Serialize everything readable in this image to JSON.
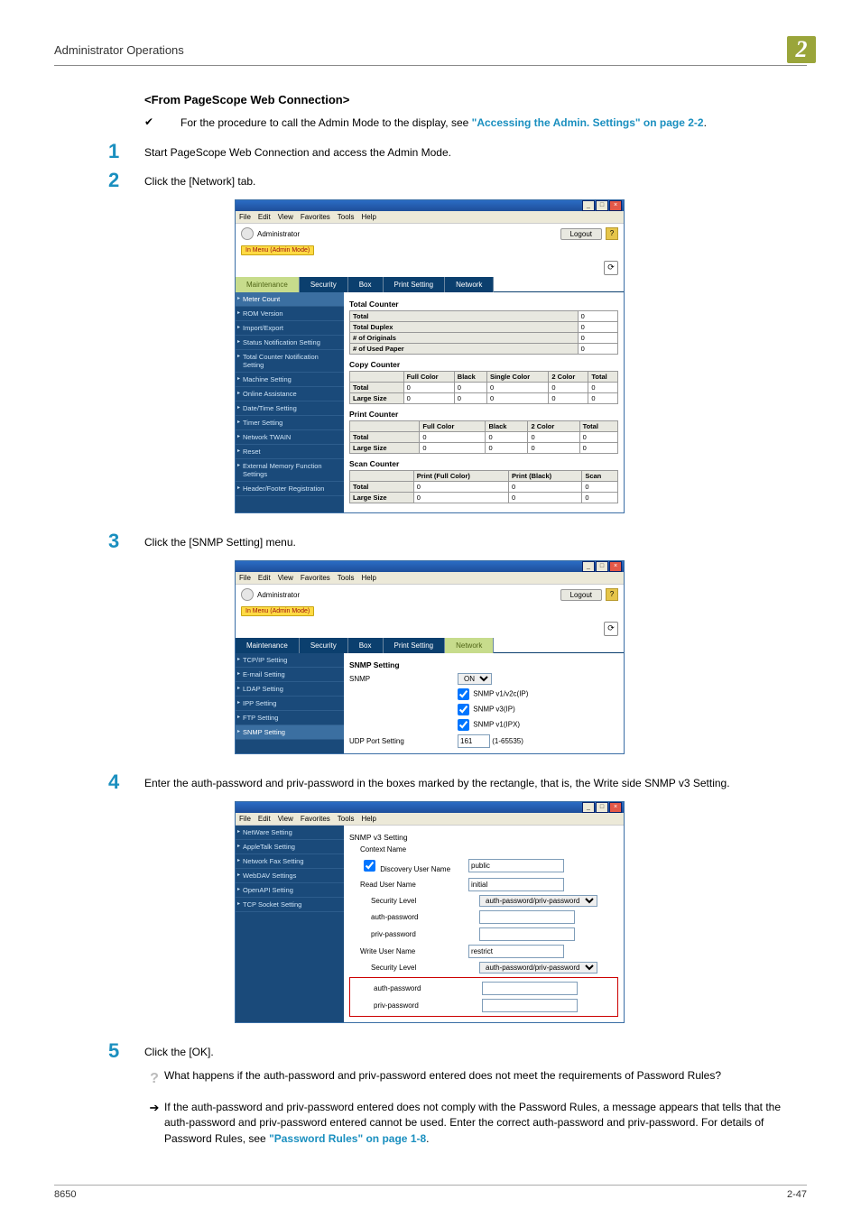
{
  "header": {
    "title": "Administrator Operations",
    "chapter": "2"
  },
  "subheading": "<From PageScope Web Connection>",
  "intro": {
    "check": "✔",
    "before_link": "For the procedure to call the Admin Mode to the display, see ",
    "link": "\"Accessing the Admin. Settings\" on page 2-2",
    "after_link": "."
  },
  "steps": {
    "s1": {
      "num": "1",
      "text": "Start PageScope Web Connection and access the Admin Mode."
    },
    "s2": {
      "num": "2",
      "text": "Click the [Network] tab."
    },
    "s3": {
      "num": "3",
      "text": "Click the [SNMP Setting] menu."
    },
    "s4": {
      "num": "4",
      "text": "Enter the auth-password and priv-password in the boxes marked by the rectangle, that is, the Write side SNMP v3 Setting."
    },
    "s5": {
      "num": "5",
      "text": "Click the [OK]."
    }
  },
  "qa": {
    "q_icon": "?",
    "q_text": "What happens if the auth-password and priv-password entered does not meet the requirements of Password Rules?",
    "a_icon": "➔",
    "a_before_link": "If the auth-password and priv-password entered does not comply with the Password Rules, a message appears that tells that the auth-password and priv-password entered cannot be used. Enter the correct auth-password and priv-password. For details of Password Rules, see ",
    "a_link": "\"Password Rules\" on page 1-8",
    "a_after_link": "."
  },
  "footer": {
    "left": "8650",
    "right": "2-47"
  },
  "browser": {
    "menus": {
      "file": "File",
      "edit": "Edit",
      "view": "View",
      "fav": "Favorites",
      "tools": "Tools",
      "help": "Help"
    },
    "admin_label": "Administrator",
    "mode_badge": "In Menu (Admin Mode)",
    "logout": "Logout",
    "q": "?",
    "win": {
      "min": "_",
      "max": "□",
      "close": "×"
    },
    "refresh": "⟳"
  },
  "tabs": {
    "maintenance": "Maintenance",
    "security": "Security",
    "box": "Box",
    "print": "Print Setting",
    "network": "Network"
  },
  "shot1": {
    "sidebar": [
      "Meter Count",
      "ROM Version",
      "Import/Export",
      "Status Notification Setting",
      "Total Counter Notification Setting",
      "Machine Setting",
      "Online Assistance",
      "Date/Time Setting",
      "Timer Setting",
      "Network TWAIN",
      "Reset",
      "External Memory Function Settings",
      "Header/Footer Registration"
    ],
    "total_counter_title": "Total Counter",
    "total_counter_rows": {
      "Total": "0",
      "Total Duplex": "0",
      "# of Originals": "0",
      "# of Used Paper": "0"
    },
    "copy_counter_title": "Copy Counter",
    "copy_headers": [
      "",
      "Full Color",
      "Black",
      "Single Color",
      "2 Color",
      "Total"
    ],
    "copy_rows": [
      [
        "Total",
        "0",
        "0",
        "0",
        "0",
        "0"
      ],
      [
        "Large Size",
        "0",
        "0",
        "0",
        "0",
        "0"
      ]
    ],
    "print_counter_title": "Print Counter",
    "print_headers": [
      "",
      "Full Color",
      "Black",
      "2 Color",
      "Total"
    ],
    "print_rows": [
      [
        "Total",
        "0",
        "0",
        "0",
        "0"
      ],
      [
        "Large Size",
        "0",
        "0",
        "0",
        "0"
      ]
    ],
    "scan_counter_title": "Scan Counter",
    "scan_headers": [
      "",
      "Print (Full Color)",
      "Print (Black)",
      "Scan"
    ],
    "scan_rows": [
      [
        "Total",
        "0",
        "0",
        "0"
      ],
      [
        "Large Size",
        "0",
        "0",
        "0"
      ]
    ]
  },
  "shot2": {
    "sidebar": [
      "TCP/IP Setting",
      "E-mail Setting",
      "LDAP Setting",
      "IPP Setting",
      "FTP Setting",
      "SNMP Setting"
    ],
    "title": "SNMP Setting",
    "rows": {
      "snmp_label": "SNMP",
      "snmp_value": "ON",
      "cb1": "SNMP v1/v2c(IP)",
      "cb2": "SNMP v3(IP)",
      "cb3": "SNMP v1(IPX)",
      "udp_label": "UDP Port Setting",
      "udp_value": "161",
      "udp_range": "(1-65535)"
    }
  },
  "shot3": {
    "sidebar": [
      "NetWare Setting",
      "AppleTalk Setting",
      "Network Fax Setting",
      "WebDAV Settings",
      "OpenAPI Setting",
      "TCP Socket Setting"
    ],
    "title": "SNMP v3 Setting",
    "rows": {
      "context": "Context Name",
      "discovery_cb": "Discovery User Name",
      "discovery_val": "public",
      "read_user": "Read User Name",
      "read_val": "initial",
      "sec_level": "Security Level",
      "sec_val": "auth-password/priv-password",
      "auth_pw": "auth-password",
      "priv_pw": "priv-password",
      "write_user": "Write User Name",
      "write_val": "restrict"
    }
  }
}
